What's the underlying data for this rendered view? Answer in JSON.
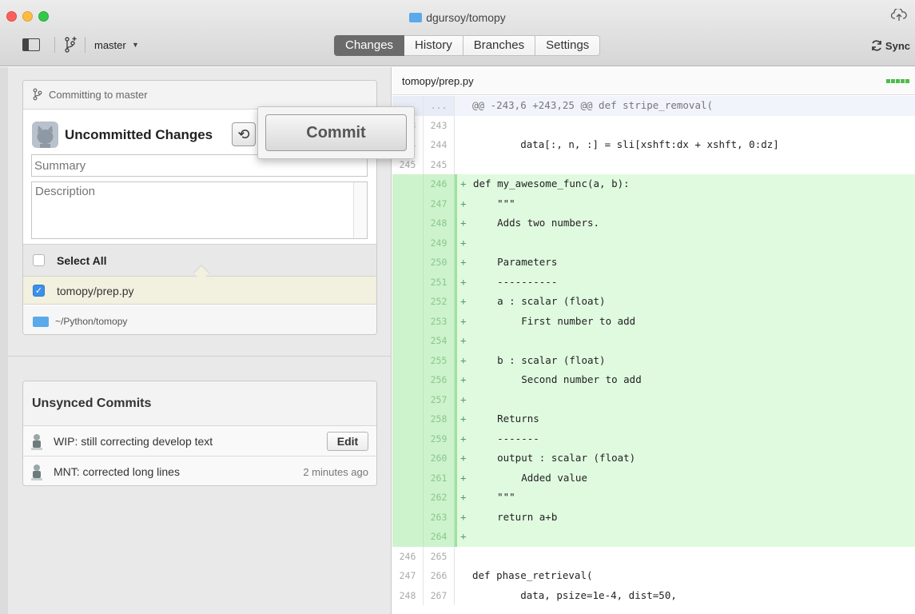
{
  "window": {
    "title": "dgursoy/tomopy",
    "branch": "master"
  },
  "toolbar": {
    "tabs": [
      "Changes",
      "History",
      "Branches",
      "Settings"
    ],
    "active_tab": "Changes",
    "sync_label": "Sync"
  },
  "commit_panel": {
    "header": "Committing to master",
    "title": "Uncommitted Changes",
    "summary_placeholder": "Summary",
    "description_placeholder": "Description",
    "select_all_label": "Select All",
    "file_label": "tomopy/prep.py",
    "repo_label": "~/Python/tomopy"
  },
  "popover": {
    "commit_label": "Commit"
  },
  "unsynced": {
    "header": "Unsynced Commits",
    "commits": [
      {
        "message": "WIP: still correcting develop text",
        "action": "Edit"
      },
      {
        "message": "MNT: corrected long lines",
        "time": "2 minutes ago"
      }
    ]
  },
  "diff": {
    "file": "tomopy/prep.py",
    "lines": [
      {
        "type": "hunk",
        "old": "...",
        "new": "...",
        "text": "@@ -243,6 +243,25 @@ def stripe_removal("
      },
      {
        "type": "ctx",
        "old": "243",
        "new": "243",
        "text": ""
      },
      {
        "type": "ctx",
        "old": "244",
        "new": "244",
        "text": "        data[:, n, :] = sli[xshft:dx + xshft, 0:dz]"
      },
      {
        "type": "ctx",
        "old": "245",
        "new": "245",
        "text": ""
      },
      {
        "type": "add",
        "old": "",
        "new": "246",
        "text": "def my_awesome_func(a, b):"
      },
      {
        "type": "add",
        "old": "",
        "new": "247",
        "text": "    \"\"\""
      },
      {
        "type": "add",
        "old": "",
        "new": "248",
        "text": "    Adds two numbers."
      },
      {
        "type": "add",
        "old": "",
        "new": "249",
        "text": ""
      },
      {
        "type": "add",
        "old": "",
        "new": "250",
        "text": "    Parameters"
      },
      {
        "type": "add",
        "old": "",
        "new": "251",
        "text": "    ----------"
      },
      {
        "type": "add",
        "old": "",
        "new": "252",
        "text": "    a : scalar (float)"
      },
      {
        "type": "add",
        "old": "",
        "new": "253",
        "text": "        First number to add"
      },
      {
        "type": "add",
        "old": "",
        "new": "254",
        "text": ""
      },
      {
        "type": "add",
        "old": "",
        "new": "255",
        "text": "    b : scalar (float)"
      },
      {
        "type": "add",
        "old": "",
        "new": "256",
        "text": "        Second number to add"
      },
      {
        "type": "add",
        "old": "",
        "new": "257",
        "text": ""
      },
      {
        "type": "add",
        "old": "",
        "new": "258",
        "text": "    Returns"
      },
      {
        "type": "add",
        "old": "",
        "new": "259",
        "text": "    -------"
      },
      {
        "type": "add",
        "old": "",
        "new": "260",
        "text": "    output : scalar (float)"
      },
      {
        "type": "add",
        "old": "",
        "new": "261",
        "text": "        Added value"
      },
      {
        "type": "add",
        "old": "",
        "new": "262",
        "text": "    \"\"\""
      },
      {
        "type": "add",
        "old": "",
        "new": "263",
        "text": "    return a+b"
      },
      {
        "type": "add",
        "old": "",
        "new": "264",
        "text": ""
      },
      {
        "type": "ctx",
        "old": "246",
        "new": "265",
        "text": ""
      },
      {
        "type": "ctx",
        "old": "247",
        "new": "266",
        "text": "def phase_retrieval("
      },
      {
        "type": "ctx",
        "old": "248",
        "new": "267",
        "text": "        data, psize=1e-4, dist=50,"
      }
    ]
  },
  "colors": {
    "accent": "#3c90e7",
    "added_bg": "#e0fae0",
    "active_tab": "#6b6b6b"
  }
}
